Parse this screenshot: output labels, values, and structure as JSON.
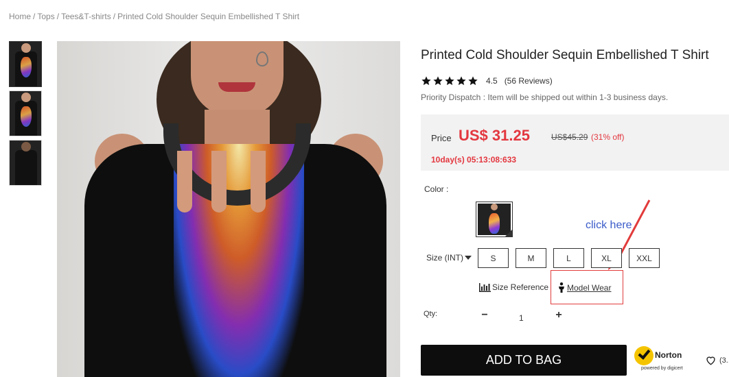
{
  "breadcrumb": {
    "items": [
      "Home",
      "Tops",
      "Tees&T-shirts",
      "Printed Cold Shoulder Sequin Embellished T Shirt"
    ],
    "separator": "/"
  },
  "product": {
    "title": "Printed Cold Shoulder Sequin Embellished T Shirt",
    "rating": {
      "stars": 5,
      "score": "4.5",
      "reviews": "(56 Reviews)"
    },
    "dispatch": "Priority Dispatch : Item will be shipped out within 1-3 business days.",
    "price": {
      "label": "Price",
      "current": "US$ 31.25",
      "original": "US$45.29",
      "discount": "(31% off)",
      "countdown": "10day(s) 05:13:08:633"
    },
    "color": {
      "label": "Color :"
    },
    "size": {
      "label": "Size (INT)",
      "options": [
        "S",
        "M",
        "L",
        "XL",
        "XXL"
      ],
      "reference_label": "Size Reference",
      "model_wear_label": "Model Wear"
    },
    "quantity": {
      "label": "Qty:",
      "minus": "−",
      "value": "1",
      "plus": "+"
    },
    "add_to_bag": "ADD TO BAG",
    "wishlist_count": "(3..."
  },
  "annotation": {
    "text": "click here",
    "color": "#3a5bc9",
    "box_color": "#e23b3b"
  },
  "norton": {
    "brand": "Norton",
    "powered": "powered by digicert"
  },
  "colors": {
    "accent_red": "#e3373f",
    "button_bg": "#0d0d0d",
    "price_box_bg": "#f2f2f2"
  }
}
